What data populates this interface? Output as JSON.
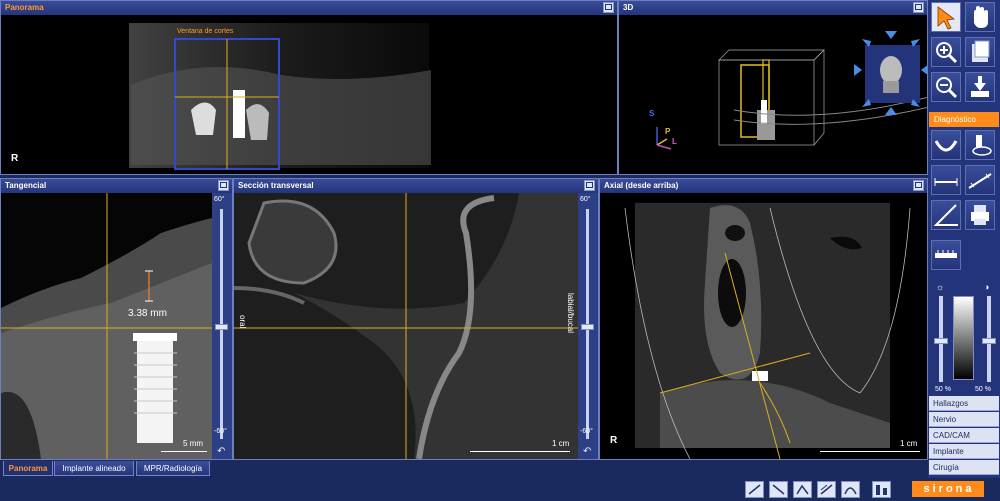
{
  "panels": {
    "panorama": {
      "title": "Panorama",
      "window_label": "Ventana de cortes",
      "orientation": "R"
    },
    "three_d": {
      "title": "3D",
      "axis_s": "S",
      "axis_p": "P",
      "axis_l": "L"
    },
    "tangential": {
      "title": "Tangencial",
      "measurement": "3.38 mm",
      "scale": "5 mm",
      "slider_top": "60°",
      "slider_bottom": "-60°"
    },
    "cross_section": {
      "title": "Sección transversal",
      "left_label": "oral",
      "right_label": "labial/bucal",
      "scale": "1 cm",
      "slider_top": "60°",
      "slider_bottom": "-60°"
    },
    "axial": {
      "title": "Axial (desde arriba)",
      "orientation": "R",
      "scale": "1 cm"
    }
  },
  "tabs": [
    {
      "label": "Panorama",
      "active": true
    },
    {
      "label": "Implante alineado",
      "active": false
    },
    {
      "label": "MPR/Radiología",
      "active": false
    }
  ],
  "toolbar": {
    "diagnostic_label": "Diagnóstico",
    "contrast_left": "50 %",
    "contrast_right": "50 %",
    "list_items": [
      "Hallazgos",
      "Nervio",
      "CAD/CAM",
      "Implante",
      "Cirugía"
    ]
  },
  "brand": "sirona",
  "colors": {
    "accent": "#ff9933",
    "frame": "#1b2a5e",
    "crosshair": "#d8b020"
  }
}
